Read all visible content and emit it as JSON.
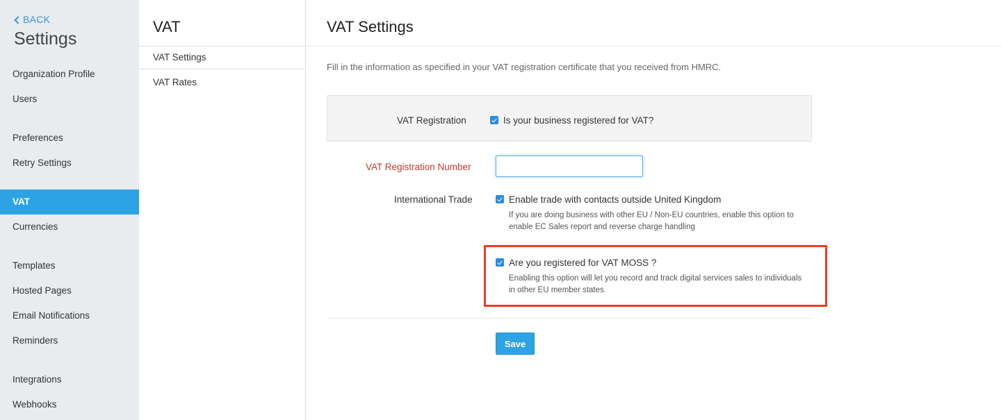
{
  "sidebar": {
    "back_label": "BACK",
    "title": "Settings",
    "items": [
      {
        "label": "Organization Profile"
      },
      {
        "label": "Users"
      },
      {
        "label": "Preferences"
      },
      {
        "label": "Retry Settings"
      },
      {
        "label": "VAT",
        "active": true
      },
      {
        "label": "Currencies"
      },
      {
        "label": "Templates"
      },
      {
        "label": "Hosted Pages"
      },
      {
        "label": "Email Notifications"
      },
      {
        "label": "Reminders"
      },
      {
        "label": "Integrations"
      },
      {
        "label": "Webhooks"
      }
    ]
  },
  "subnav": {
    "title": "VAT",
    "items": [
      {
        "label": "VAT Settings"
      },
      {
        "label": "VAT Rates"
      }
    ]
  },
  "main": {
    "title": "VAT Settings",
    "intro": "Fill in the information as specified in your VAT registration certificate that you received from HMRC.",
    "vat_registration": {
      "label": "VAT Registration",
      "checkbox_label": "Is your business registered for VAT?",
      "checked": true
    },
    "vat_number": {
      "label": "VAT Registration Number",
      "value": "",
      "placeholder": ""
    },
    "international_trade": {
      "label": "International Trade",
      "checkbox_label": "Enable trade with contacts outside United Kingdom",
      "checked": true,
      "help_line1": "If you are doing business with other EU / Non-EU countries, enable this option to",
      "help_line2": "enable EC Sales report and reverse charge handling"
    },
    "vat_moss": {
      "checkbox_label": "Are you registered for VAT MOSS ?",
      "checked": true,
      "help_line1": "Enabling this option will let you record and track digital services sales to individuals",
      "help_line2": "in other EU member states."
    },
    "save_label": "Save"
  },
  "colors": {
    "accent": "#2ea3e3",
    "required_label": "#c0392b",
    "highlight_border": "#ee3a26",
    "sidebar_bg": "#e8ecef"
  }
}
